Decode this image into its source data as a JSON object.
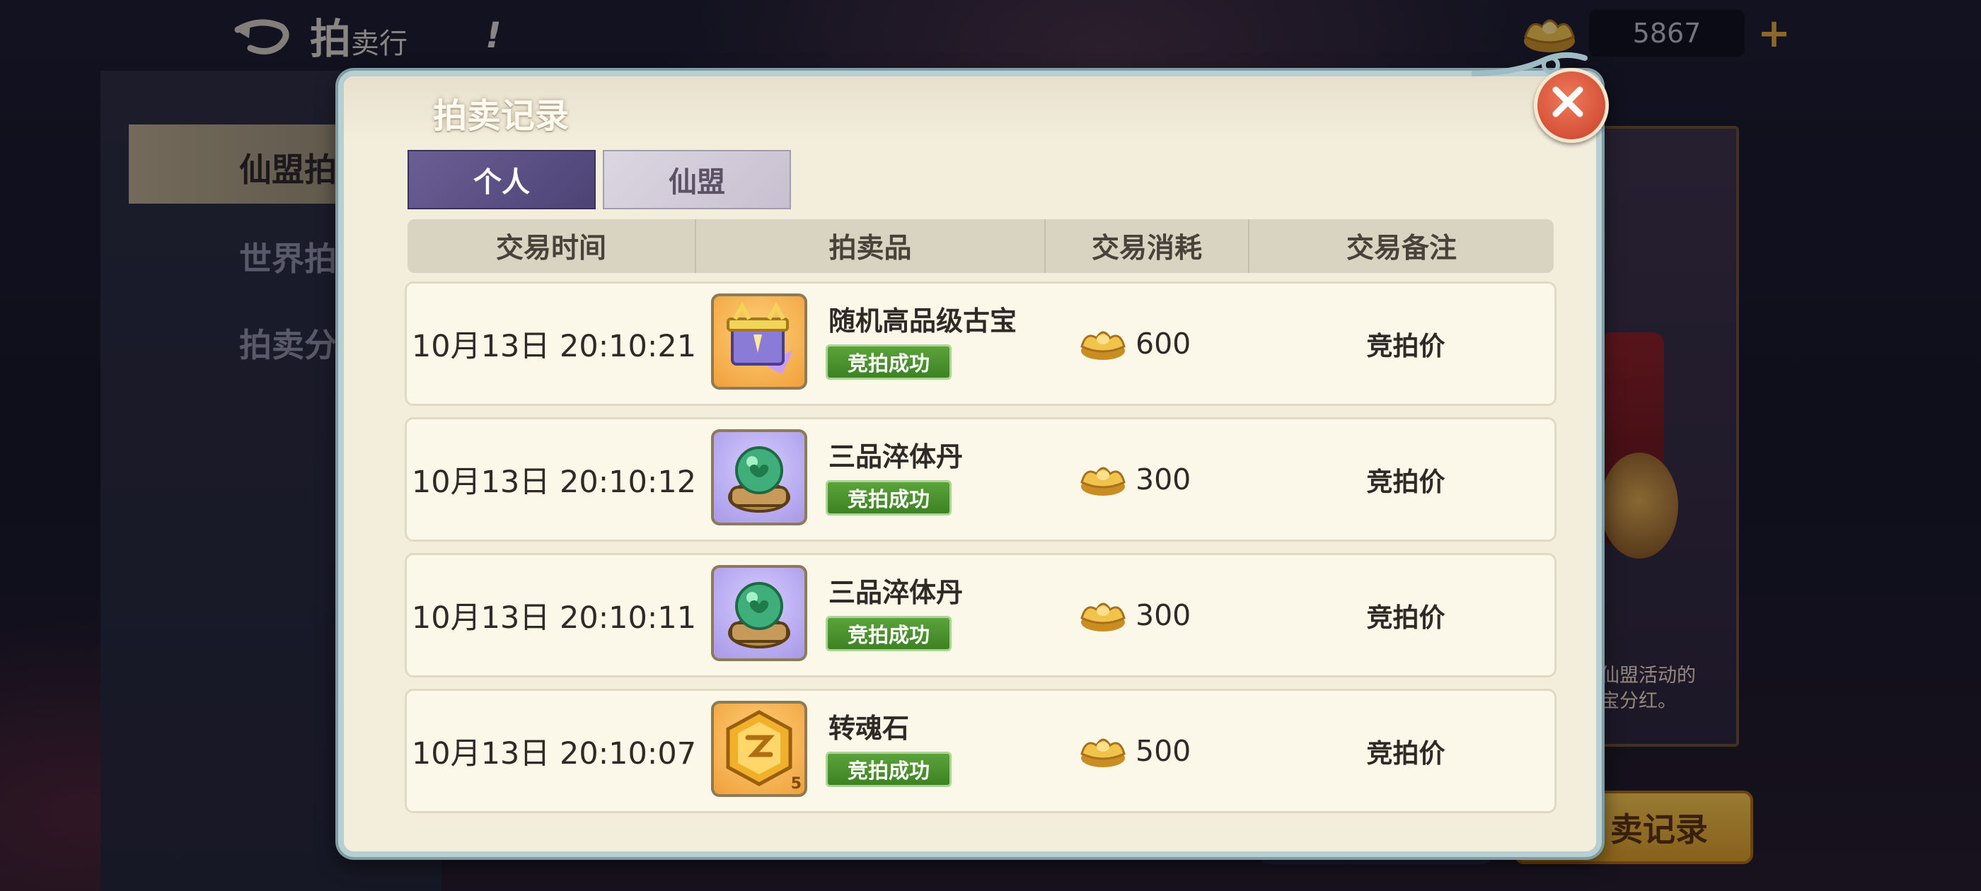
{
  "background": {
    "header_title_main": "拍",
    "header_title_rest": "卖行",
    "header_alert": "!",
    "currency_value": "5867",
    "currency_plus": "+",
    "sidebar_items": [
      "仙盟拍",
      "世界拍",
      "拍卖分"
    ],
    "right_panel_note_line1": "仙盟活动的",
    "right_panel_note_line2": "宝分红。",
    "record_button_label": "卖记录"
  },
  "modal": {
    "title": "拍卖记录",
    "tabs": [
      {
        "label": "个人",
        "active": true
      },
      {
        "label": "仙盟",
        "active": false
      }
    ],
    "columns": [
      "交易时间",
      "拍卖品",
      "交易消耗",
      "交易备注"
    ],
    "rows": [
      {
        "time": "10月13日 20:10:21",
        "item_name": "随机高品级古宝",
        "item_icon": "ancient-treasure-icon",
        "status": "竞拍成功",
        "cost": "600",
        "note": "竞拍价"
      },
      {
        "time": "10月13日 20:10:12",
        "item_name": "三品淬体丹",
        "item_icon": "green-pill-icon",
        "status": "竞拍成功",
        "cost": "300",
        "note": "竞拍价"
      },
      {
        "time": "10月13日 20:10:11",
        "item_name": "三品淬体丹",
        "item_icon": "green-pill-icon",
        "status": "竞拍成功",
        "cost": "300",
        "note": "竞拍价"
      },
      {
        "time": "10月13日 20:10:07",
        "item_name": "转魂石",
        "item_icon": "soul-stone-icon",
        "status": "竞拍成功",
        "cost": "500",
        "note": "竞拍价",
        "stack_count": "5"
      }
    ]
  },
  "colors": {
    "active_tab": "#5a4f85",
    "badge_green": "#4a9030",
    "close_red": "#d9533a",
    "modal_bg": "#f3eddc"
  }
}
